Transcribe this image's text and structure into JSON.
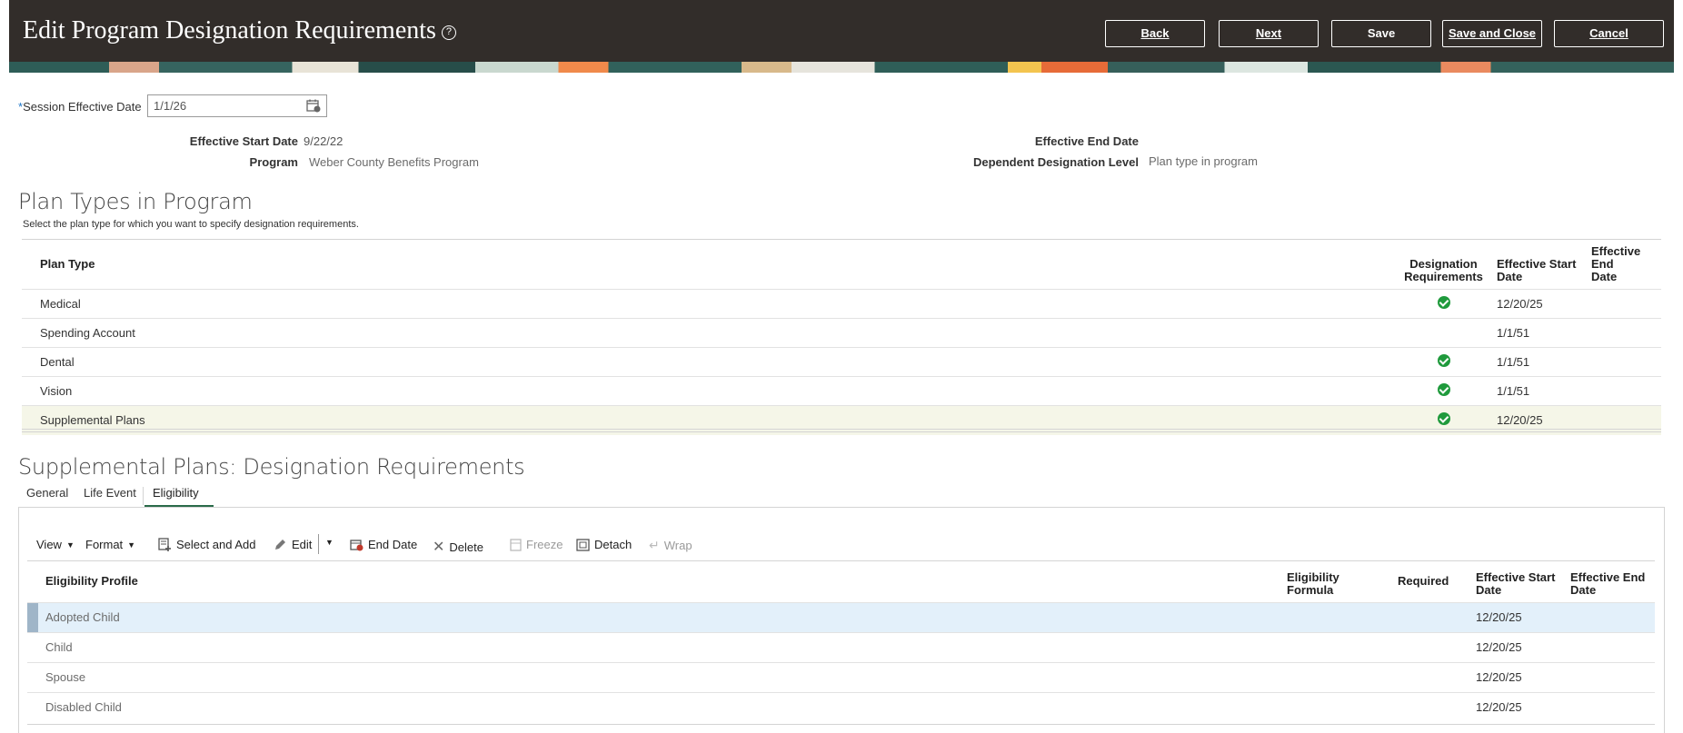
{
  "header": {
    "title": "Edit Program Designation Requirements",
    "help_icon": "?",
    "buttons": {
      "back": "Back",
      "next": "Next",
      "save": "Save",
      "save_close": "Save and Close",
      "cancel": "Cancel"
    }
  },
  "session": {
    "label": "Session Effective Date",
    "required_marker": "*",
    "value": "1/1/26"
  },
  "details": {
    "effective_start_label": "Effective Start Date",
    "effective_start_value": "9/22/22",
    "program_label": "Program",
    "program_value": "Weber County Benefits Program",
    "effective_end_label": "Effective End Date",
    "effective_end_value": "",
    "dep_level_label": "Dependent Designation Level",
    "dep_level_value": "Plan type in program"
  },
  "plan_types": {
    "title": "Plan Types in Program",
    "hint": "Select the plan type for which you want to specify designation requirements.",
    "columns": {
      "plan_type": "Plan Type",
      "designation_1": "Designation",
      "designation_2": "Requirements",
      "start_1": "Effective Start",
      "start_2": "Date",
      "end_1": "Effective End",
      "end_2": "Date"
    },
    "rows": [
      {
        "plan_type": "Medical",
        "designation": true,
        "start": "12/20/25",
        "end": ""
      },
      {
        "plan_type": "Spending Account",
        "designation": false,
        "start": "1/1/51",
        "end": ""
      },
      {
        "plan_type": "Dental",
        "designation": true,
        "start": "1/1/51",
        "end": ""
      },
      {
        "plan_type": "Vision",
        "designation": true,
        "start": "1/1/51",
        "end": ""
      },
      {
        "plan_type": "Supplemental Plans",
        "designation": true,
        "start": "12/20/25",
        "end": "",
        "selected": true
      }
    ]
  },
  "designation": {
    "title": "Supplemental Plans: Designation Requirements",
    "tabs": [
      "General",
      "Life Event",
      "Eligibility"
    ],
    "active_tab": "Eligibility",
    "toolbar": {
      "view": "View",
      "format": "Format",
      "select_add": "Select and Add",
      "edit": "Edit",
      "end_date": "End Date",
      "delete": "Delete",
      "freeze": "Freeze",
      "detach": "Detach",
      "wrap": "Wrap"
    },
    "columns": {
      "profile": "Eligibility Profile",
      "formula_1": "Eligibility",
      "formula_2": "Formula",
      "required": "Required",
      "start_1": "Effective Start",
      "start_2": "Date",
      "end_1": "Effective End",
      "end_2": "Date"
    },
    "rows": [
      {
        "profile": "Adopted Child",
        "formula": "",
        "required": "",
        "start": "12/20/25",
        "end": "",
        "selected": true
      },
      {
        "profile": "Child",
        "formula": "",
        "required": "",
        "start": "12/20/25",
        "end": ""
      },
      {
        "profile": "Spouse",
        "formula": "",
        "required": "",
        "start": "12/20/25",
        "end": ""
      },
      {
        "profile": "Disabled Child",
        "formula": "",
        "required": "",
        "start": "12/20/25",
        "end": ""
      }
    ]
  },
  "colors": {
    "header_bg": "#322d2a",
    "selected_row_plan": "#f5f6e8",
    "selected_row_elig": "#e3f0fa",
    "check_green": "#1f9a3c"
  }
}
